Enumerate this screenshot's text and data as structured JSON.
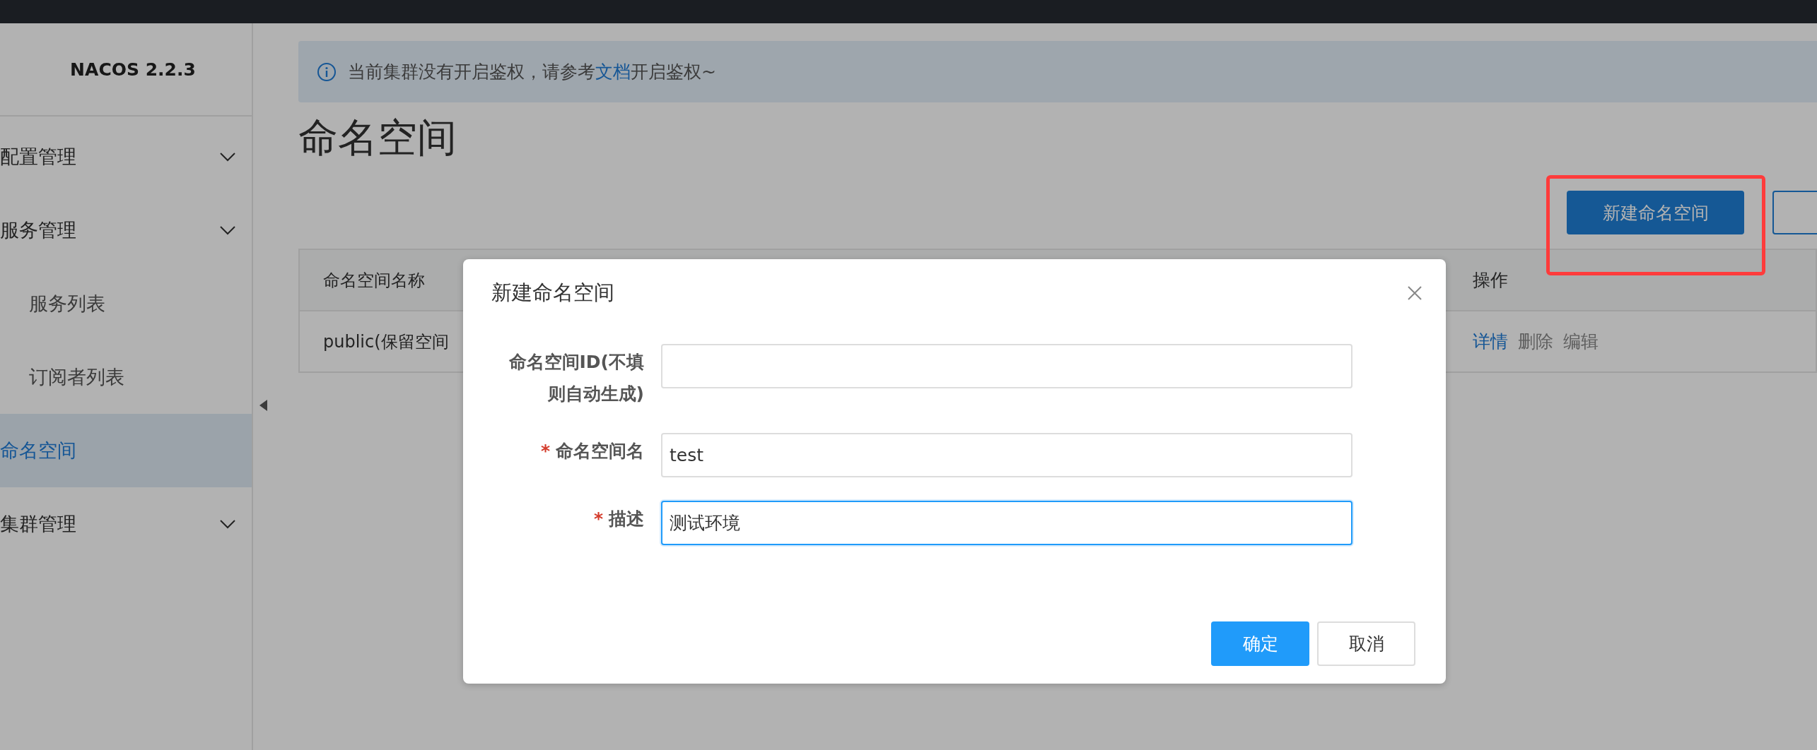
{
  "sidebar": {
    "title": "NACOS 2.2.3",
    "items": [
      {
        "label": "配置管理",
        "kind": "group",
        "selected": false
      },
      {
        "label": "服务管理",
        "kind": "group",
        "selected": false,
        "children": [
          {
            "label": "服务列表",
            "selected": false
          },
          {
            "label": "订阅者列表",
            "selected": false
          }
        ]
      },
      {
        "label": "命名空间",
        "kind": "link",
        "selected": true
      },
      {
        "label": "集群管理",
        "kind": "group",
        "selected": false
      }
    ]
  },
  "notice": {
    "text": "当前集群没有开启鉴权，请参考",
    "link": "文档",
    "text_after": "开启鉴权~"
  },
  "page_title": "命名空间",
  "toolbar": [
    {
      "label": "新建命名空间",
      "kind": "primary",
      "highlighted": true
    },
    {
      "kind": "outline"
    }
  ],
  "table": {
    "columns": [
      "命名空间名称",
      "操作"
    ],
    "rows": [
      {
        "name": "public(保留空间",
        "actions": [
          {
            "label": "详情",
            "kind": "primary"
          },
          {
            "label": "删除",
            "kind": "muted"
          },
          {
            "label": "编辑",
            "kind": "muted"
          }
        ]
      }
    ]
  },
  "dialog": {
    "title": "新建命名空间",
    "fields": [
      {
        "label": "命名空间ID(不填则自动生成)",
        "focused": false
      },
      {
        "label": "命名空间名",
        "marker": "*",
        "value": "test",
        "focused": false
      },
      {
        "label": "描述",
        "marker": "*",
        "value": "测试环境",
        "focused": true
      }
    ],
    "buttons": [
      {
        "label": "确定",
        "kind": "primary"
      },
      {
        "label": "取消",
        "kind": "secondary"
      }
    ]
  }
}
